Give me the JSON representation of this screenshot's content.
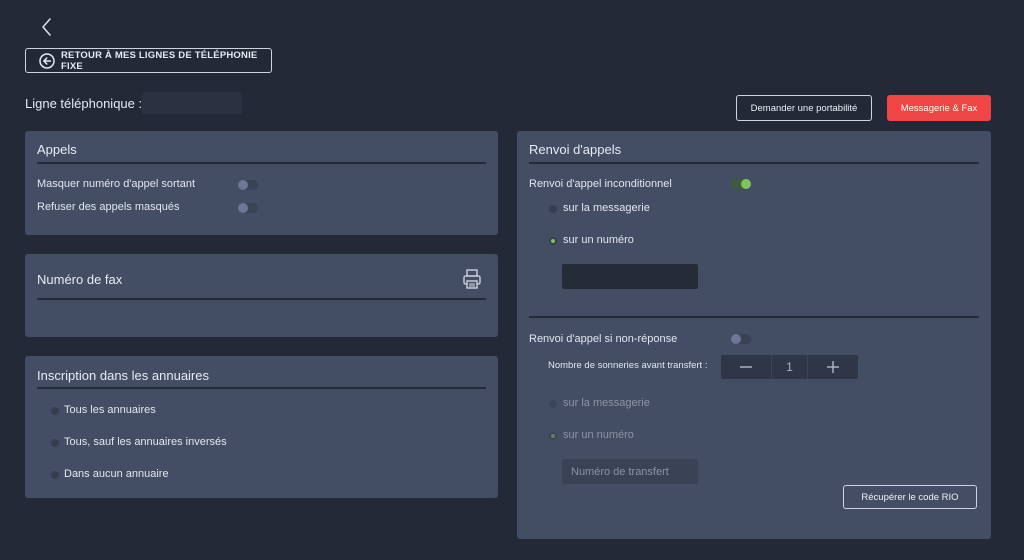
{
  "header": {
    "back_button_label": "RETOUR À MES LIGNES DE TÉLÉPHONIE FIXE",
    "line_label": "Ligne téléphonique :",
    "line_value": "",
    "portability_button": "Demander une portabilité",
    "messaging_button": "Messagerie & Fax"
  },
  "appels": {
    "title": "Appels",
    "rows": [
      {
        "label": "Masquer numéro d'appel sortant",
        "enabled": false
      },
      {
        "label": "Refuser des appels masqués",
        "enabled": false
      }
    ]
  },
  "fax": {
    "title": "Numéro de fax",
    "icon": "printer-icon"
  },
  "annuaires": {
    "title": "Inscription dans les annuaires",
    "options": [
      {
        "label": "Tous les annuaires",
        "selected": false
      },
      {
        "label": "Tous, sauf les annuaires inversés",
        "selected": false
      },
      {
        "label": "Dans aucun annuaire",
        "selected": false
      }
    ]
  },
  "renvoi": {
    "title": "Renvoi d'appels",
    "unconditional": {
      "label": "Renvoi d'appel inconditionnel",
      "enabled": true,
      "options": [
        {
          "label": "sur la messagerie",
          "selected": false
        },
        {
          "label": "sur un numéro",
          "selected": true
        }
      ],
      "number_value": ""
    },
    "no_answer": {
      "label": "Renvoi d'appel si non-réponse",
      "enabled": false,
      "rings_label": "Nombre de sonneries avant transfert :",
      "rings_value": "1",
      "options": [
        {
          "label": "sur la messagerie",
          "selected": false
        },
        {
          "label": "sur un numéro",
          "selected": true
        }
      ],
      "transfer_placeholder": "Numéro de transfert"
    },
    "rio_button": "Récupérer le code RIO"
  },
  "colors": {
    "background": "#242937",
    "card": "#434d63",
    "accent_red": "#f04545",
    "toggle_on": "#7dc75a"
  }
}
